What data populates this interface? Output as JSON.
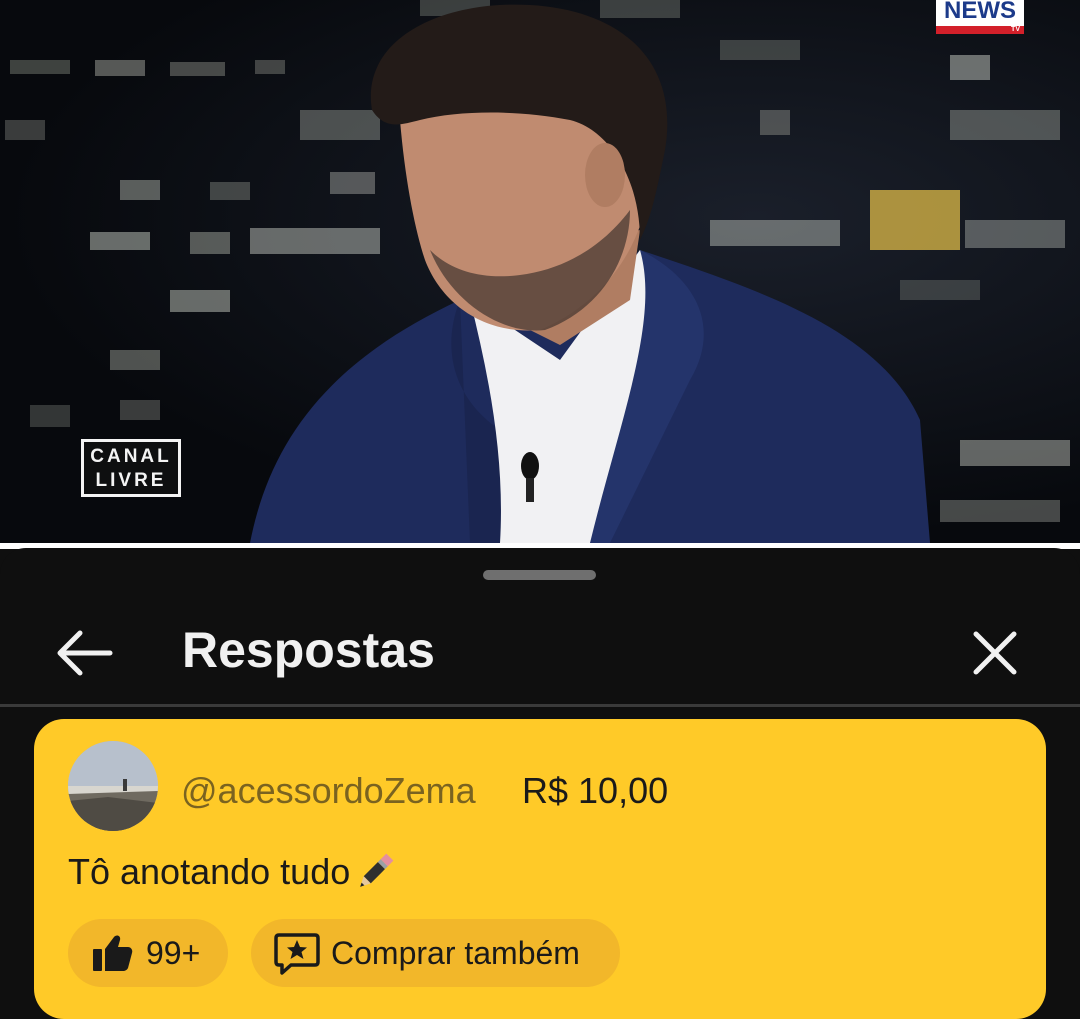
{
  "video": {
    "channel_logo": "NEWS",
    "channel_logo_sub": "TV",
    "program_logo_line1": "CANAL",
    "program_logo_line2": "LIVRE"
  },
  "sheet": {
    "title": "Respostas",
    "back_icon": "arrow-left-icon",
    "close_icon": "close-icon"
  },
  "super_chat": {
    "username": "@acessordoZema",
    "amount": "R$ 10,00",
    "message": "Tô anotando tudo",
    "message_emoji": "pencil-icon",
    "likes": "99+",
    "buy_label": "Comprar também",
    "card_color": "#ffca28",
    "button_color": "#f2b72a"
  }
}
